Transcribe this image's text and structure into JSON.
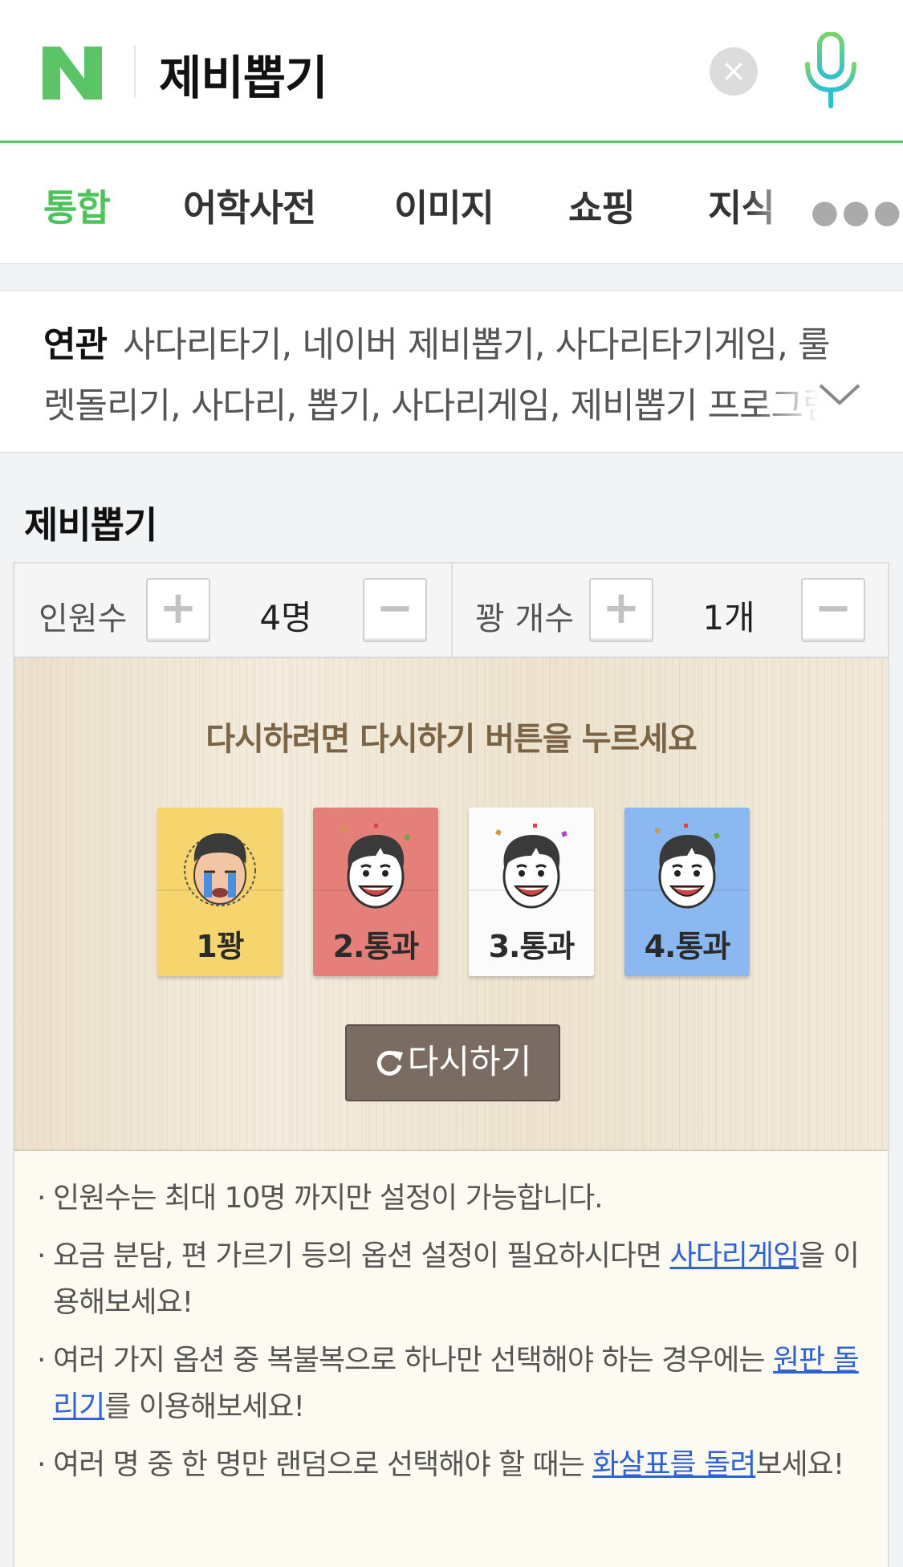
{
  "header": {
    "logo_letter": "N",
    "query": "제비뽑기",
    "clear_icon": "close-icon",
    "mic_icon": "microphone-icon"
  },
  "tabs": [
    {
      "label": "통합",
      "active": true
    },
    {
      "label": "어학사전",
      "active": false
    },
    {
      "label": "이미지",
      "active": false
    },
    {
      "label": "쇼핑",
      "active": false
    },
    {
      "label": "지식",
      "active": false
    }
  ],
  "related": {
    "label": "연관",
    "line1": "사다리타기, 네이버 제비뽑기, 사다리타기게임, 룰",
    "line2": "렛돌리기, 사다리, 뽑기, 사다리게임, 제비뽑기 프로그램"
  },
  "section_title": "제비뽑기",
  "controls": {
    "people_label": "인원수",
    "people_value": "4명",
    "bust_label": "꽝 개수",
    "bust_value": "1개",
    "plus": "+",
    "minus": "−"
  },
  "game": {
    "instruction": "다시하려면 다시하기 버튼을 누르세요",
    "cards": [
      {
        "label": "1꽝",
        "color": "#f6d46e",
        "face": "crying-face-icon"
      },
      {
        "label": "2.통과",
        "color": "#e57f7a",
        "face": "happy-face-icon"
      },
      {
        "label": "3.통과",
        "color": "#fbfbfb",
        "face": "happy-face-icon"
      },
      {
        "label": "4.통과",
        "color": "#8bb8f0",
        "face": "happy-face-icon"
      }
    ],
    "retry_label": "다시하기"
  },
  "notes": {
    "n1": "인원수는 최대 10명 까지만 설정이 가능합니다.",
    "n2_pre": "요금 분담, 편 가르기 등의 옵션 설정이 필요하시다면 ",
    "n2_link": "사다리게임",
    "n2_post": "을 이용해보세요!",
    "n3_pre": "여러 가지 옵션 중 복불복으로 하나만 선택해야 하는 경우에는 ",
    "n3_link": "원판 돌리기",
    "n3_post": "를 이용해보세요!",
    "n4_pre": "여러 명 중 한 명만 랜덤으로 선택해야 할 때는 ",
    "n4_link": "화살표를 돌려",
    "n4_post": "보세요!"
  },
  "colors": {
    "brand_green": "#4ec35b",
    "link_blue": "#2f63d1",
    "wood": "#efe5d3",
    "retry_button": "#7b6c63"
  }
}
